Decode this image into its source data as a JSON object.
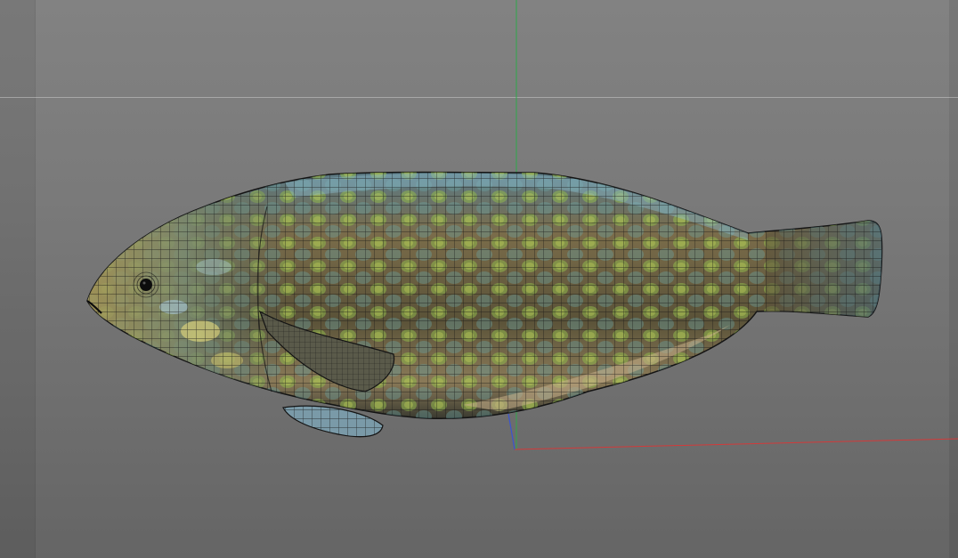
{
  "viewport": {
    "background_top": "#828282",
    "background_bottom": "#656565"
  },
  "axes": {
    "x_color": "#d23a3a",
    "y_color": "#2ea84a",
    "z_color": "#3a55d0"
  },
  "model": {
    "wireframe_color": "#141414",
    "body_base_color": "#6a6044",
    "scale_accent_color": "#8fb64a",
    "highlight_color": "#a8c8d8",
    "eye_color": "#0c0c0c"
  }
}
